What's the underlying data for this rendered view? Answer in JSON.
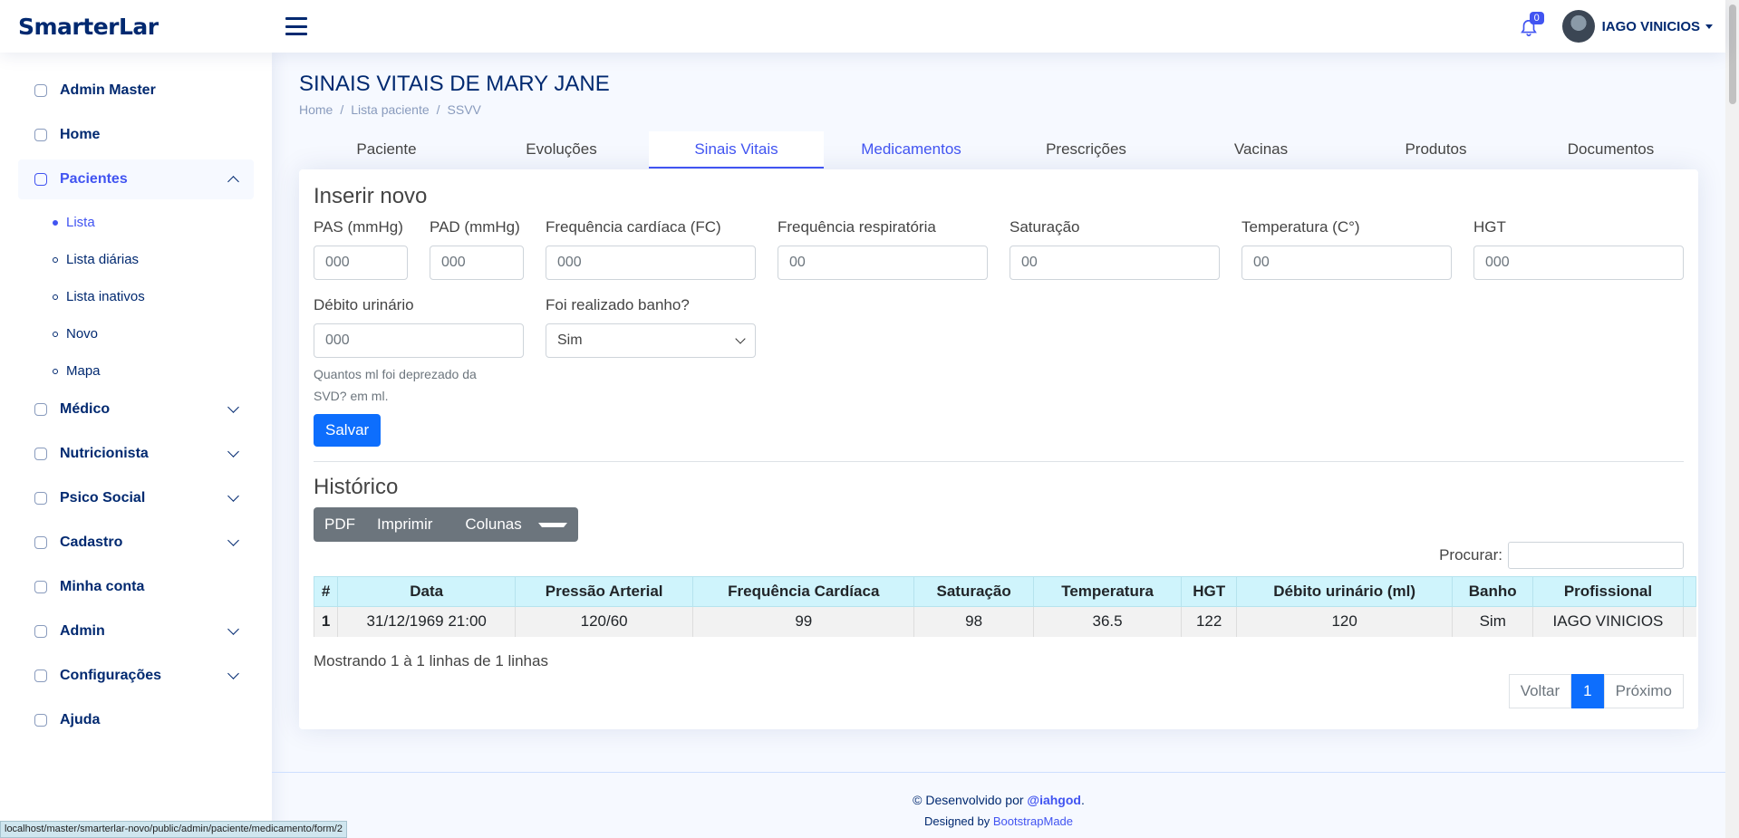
{
  "header": {
    "logo": "SmarterLar",
    "notifications_count": "0",
    "user_name": "IAGO VINICIOS"
  },
  "sidebar": {
    "items": [
      {
        "label": "Admin Master"
      },
      {
        "label": "Home"
      },
      {
        "label": "Pacientes"
      },
      {
        "label": "Médico"
      },
      {
        "label": "Nutricionista"
      },
      {
        "label": "Psico Social"
      },
      {
        "label": "Cadastro"
      },
      {
        "label": "Minha conta"
      },
      {
        "label": "Admin"
      },
      {
        "label": "Configurações"
      },
      {
        "label": "Ajuda"
      }
    ],
    "pacientes_sub": [
      {
        "label": "Lista"
      },
      {
        "label": "Lista diárias"
      },
      {
        "label": "Lista inativos"
      },
      {
        "label": "Novo"
      },
      {
        "label": "Mapa"
      }
    ]
  },
  "main": {
    "title": "SINAIS VITAIS DE MARY JANE",
    "breadcrumb": [
      "Home",
      "Lista paciente",
      "SSVV"
    ],
    "tabs": [
      "Paciente",
      "Evoluções",
      "Sinais Vitais",
      "Medicamentos",
      "Prescrições",
      "Vacinas",
      "Produtos",
      "Documentos"
    ],
    "form": {
      "title": "Inserir novo",
      "fields": [
        {
          "label": "PAS (mmHg)",
          "placeholder": "000"
        },
        {
          "label": "PAD (mmHg)",
          "placeholder": "000"
        },
        {
          "label": "Frequência cardíaca (FC)",
          "placeholder": "000"
        },
        {
          "label": "Frequência respiratória",
          "placeholder": "00"
        },
        {
          "label": "Saturação",
          "placeholder": "00"
        },
        {
          "label": "Temperatura (C°)",
          "placeholder": "00"
        },
        {
          "label": "HGT",
          "placeholder": "000"
        },
        {
          "label": "Débito urinário",
          "placeholder": "000"
        },
        {
          "label": "Foi realizado banho?",
          "value": "Sim"
        }
      ],
      "help": "Quantos ml foi deprezado da SVD? em ml.",
      "save": "Salvar"
    },
    "history": {
      "title": "Histórico",
      "buttons": [
        "PDF",
        "Imprimir",
        "Colunas"
      ],
      "search_label": "Procurar:",
      "columns": [
        "#",
        "Data",
        "Pressão Arterial",
        "Frequência Cardíaca",
        "Saturação",
        "Temperatura",
        "HGT",
        "Débito urinário (ml)",
        "Banho",
        "Profissional"
      ],
      "rows": [
        [
          "1",
          "31/12/1969 21:00",
          "120/60",
          "99",
          "98",
          "36.5",
          "122",
          "120",
          "Sim",
          "IAGO VINICIOS"
        ]
      ],
      "info": "Mostrando 1 à 1 linhas de 1 linhas",
      "pager": [
        "Voltar",
        "1",
        "Próximo"
      ]
    }
  },
  "footer": {
    "line1_prefix": "© Desenvolvido por ",
    "line1_author": "@iahgod",
    "line1_suffix": ".",
    "line2_prefix": "Designed by ",
    "line2_link": "BootstrapMade"
  },
  "statusbar": "localhost/master/smarterlar-novo/public/admin/paciente/medicamento/form/2",
  "colors": {
    "primary": "#4154f1",
    "navy": "#012970",
    "btn_primary": "#0d6efd",
    "table_head": "#cff4fc"
  }
}
